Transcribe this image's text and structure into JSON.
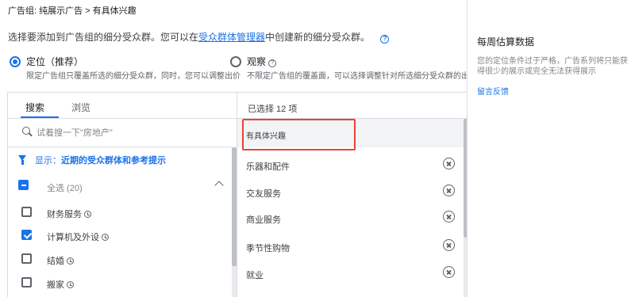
{
  "breadcrumb": "广告组: 纯展示广告 > 有具体兴趣",
  "intro": {
    "before_link": "选择要添加到广告组的细分受众群。您可以在",
    "link": "受众群体管理器",
    "after_link": "中创建新的细分受众群。",
    "help_icon": "help-circle-icon"
  },
  "targeting": {
    "option_targeting": {
      "label": "定位（推荐）",
      "description": "限定广告组只覆盖所选的细分受众群，同时，您可以调整出价",
      "selected": true
    },
    "option_observation": {
      "label": "观察",
      "description": "不限定广告组的覆盖面，可以选择调整针对所选细分受众群的出价",
      "selected": false
    }
  },
  "left_panel": {
    "tabs": [
      "搜索",
      "浏览"
    ],
    "active_tab": "搜索",
    "search_placeholder": "试着搜一下\"房地产\"",
    "filter": {
      "prefix": "显示：",
      "text": "近期的受众群体和参考提示"
    },
    "select_all": {
      "label": "全选 (20)",
      "state": "indeterminate"
    },
    "items": [
      {
        "label": "财务服务",
        "checked": false
      },
      {
        "label": "计算机及外设",
        "checked": true
      },
      {
        "label": "结婚",
        "checked": false
      },
      {
        "label": "搬家",
        "checked": false
      }
    ]
  },
  "right_selection": {
    "count_label": "已选择 12 项",
    "group_label": "有具体兴趣",
    "items": [
      "乐器和配件",
      "交友服务",
      "商业服务",
      "季节性购物",
      "就业"
    ]
  },
  "side_panel": {
    "title": "每周估算数据",
    "text": "您的定位条件过于严格，广告系列将只能获得很少的展示或完全无法获得展示",
    "feedback_link": "留言反馈"
  },
  "colors": {
    "accent": "#1a73e8",
    "highlight": "#ea4335"
  }
}
